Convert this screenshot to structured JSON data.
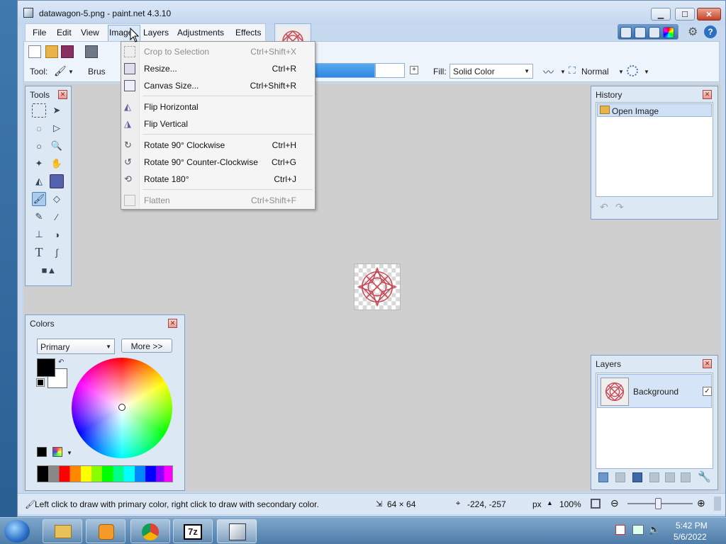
{
  "window": {
    "title": "datawagon-5.png - paint.net 4.3.10"
  },
  "menubar": {
    "items": [
      "File",
      "Edit",
      "View",
      "Image",
      "Layers",
      "Adjustments",
      "Effects"
    ]
  },
  "toolbar": {
    "tool_label": "Tool:",
    "brush_label": "Brus",
    "fill_label": "Fill:",
    "fill_value": "Solid Color",
    "blend_value": "Normal"
  },
  "image_menu": {
    "items": [
      {
        "label": "Crop to Selection",
        "shortcut": "Ctrl+Shift+X",
        "enabled": false,
        "icon": "crop-icon"
      },
      {
        "label": "Resize...",
        "shortcut": "Ctrl+R",
        "enabled": true,
        "icon": "resize-icon"
      },
      {
        "label": "Canvas Size...",
        "shortcut": "Ctrl+Shift+R",
        "enabled": true,
        "icon": "canvas-size-icon"
      },
      {
        "label": "Flip Horizontal",
        "shortcut": "",
        "enabled": true,
        "icon": "flip-horizontal-icon"
      },
      {
        "label": "Flip Vertical",
        "shortcut": "",
        "enabled": true,
        "icon": "flip-vertical-icon"
      },
      {
        "label": "Rotate 90° Clockwise",
        "shortcut": "Ctrl+H",
        "enabled": true,
        "icon": "rotate-cw-icon"
      },
      {
        "label": "Rotate 90° Counter-Clockwise",
        "shortcut": "Ctrl+G",
        "enabled": true,
        "icon": "rotate-ccw-icon"
      },
      {
        "label": "Rotate 180°",
        "shortcut": "Ctrl+J",
        "enabled": true,
        "icon": "rotate-180-icon"
      },
      {
        "label": "Flatten",
        "shortcut": "Ctrl+Shift+F",
        "enabled": false,
        "icon": "flatten-icon"
      }
    ]
  },
  "tools_panel": {
    "title": "Tools"
  },
  "colors_panel": {
    "title": "Colors",
    "mode": "Primary",
    "more_label": "More >>",
    "primary_color": "#000000",
    "secondary_color": "#ffffff"
  },
  "history_panel": {
    "title": "History",
    "items": [
      "Open Image"
    ]
  },
  "layers_panel": {
    "title": "Layers",
    "items": [
      {
        "name": "Background",
        "visible": true
      }
    ]
  },
  "statusbar": {
    "hint": "Left click to draw with primary color, right click to draw with secondary color.",
    "image_size": "64 × 64",
    "cursor_pos": "-224, -257",
    "unit": "px",
    "zoom": "100%"
  },
  "taskbar": {
    "time": "5:42 PM",
    "date": "5/6/2022",
    "apps": [
      "file-explorer-icon",
      "media-player-icon",
      "chrome-icon",
      "7zip-icon",
      "paintnet-icon"
    ]
  }
}
